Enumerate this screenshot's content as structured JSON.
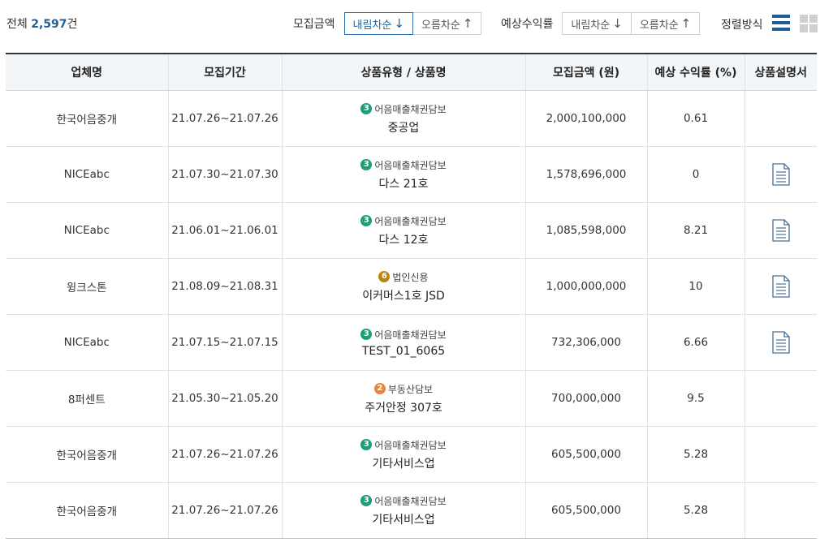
{
  "header": {
    "total_prefix": "전체",
    "total_count": "2,597",
    "total_suffix": "건",
    "sort_amount": {
      "label": "모집금액",
      "desc_label": "내림차순",
      "asc_label": "오름차순"
    },
    "sort_rate": {
      "label": "예상수익률",
      "desc_label": "내림차순",
      "asc_label": "오름차순"
    },
    "view_label": "정렬방식"
  },
  "table": {
    "columns": [
      "업체명",
      "모집기간",
      "상품유형 / 상품명",
      "모집금액 (원)",
      "예상 수익률 (%)",
      "상품설명서"
    ],
    "rows": [
      {
        "company": "한국어음중개",
        "period": "21.07.26~21.07.26",
        "type_num": "3",
        "type": "어음매출채권담보",
        "name": "중공업",
        "amount": "2,000,100,000",
        "rate": "0.61",
        "doc": false
      },
      {
        "company": "NICEabc",
        "period": "21.07.30~21.07.30",
        "type_num": "3",
        "type": "어음매출채권담보",
        "name": "다스 21호",
        "amount": "1,578,696,000",
        "rate": "0",
        "doc": true
      },
      {
        "company": "NICEabc",
        "period": "21.06.01~21.06.01",
        "type_num": "3",
        "type": "어음매출채권담보",
        "name": "다스 12호",
        "amount": "1,085,598,000",
        "rate": "8.21",
        "doc": true
      },
      {
        "company": "윙크스톤",
        "period": "21.08.09~21.08.31",
        "type_num": "6",
        "type": "법인신용",
        "name": "이커머스1호 JSD",
        "amount": "1,000,000,000",
        "rate": "10",
        "doc": true
      },
      {
        "company": "NICEabc",
        "period": "21.07.15~21.07.15",
        "type_num": "3",
        "type": "어음매출채권담보",
        "name": "TEST_01_6065",
        "amount": "732,306,000",
        "rate": "6.66",
        "doc": true
      },
      {
        "company": "8퍼센트",
        "period": "21.05.30~21.05.20",
        "type_num": "2",
        "type": "부동산담보",
        "name": "주거안정 307호",
        "amount": "700,000,000",
        "rate": "9.5",
        "doc": false
      },
      {
        "company": "한국어음중개",
        "period": "21.07.26~21.07.26",
        "type_num": "3",
        "type": "어음매출채권담보",
        "name": "기타서비스업",
        "amount": "605,500,000",
        "rate": "5.28",
        "doc": false
      },
      {
        "company": "한국어음중개",
        "period": "21.07.26~21.07.26",
        "type_num": "3",
        "type": "어음매출채권담보",
        "name": "기타서비스업",
        "amount": "605,500,000",
        "rate": "5.28",
        "doc": false
      }
    ]
  },
  "icons": {
    "sort_desc": "arrow-down-icon",
    "sort_asc": "arrow-up-icon",
    "view_list": "list-view-icon",
    "view_grid": "grid-view-icon",
    "document": "document-icon"
  },
  "colors": {
    "accent": "#1f5e99",
    "badge_3": "#1f9e7a",
    "badge_6": "#b8860b",
    "badge_2": "#f0823a"
  }
}
